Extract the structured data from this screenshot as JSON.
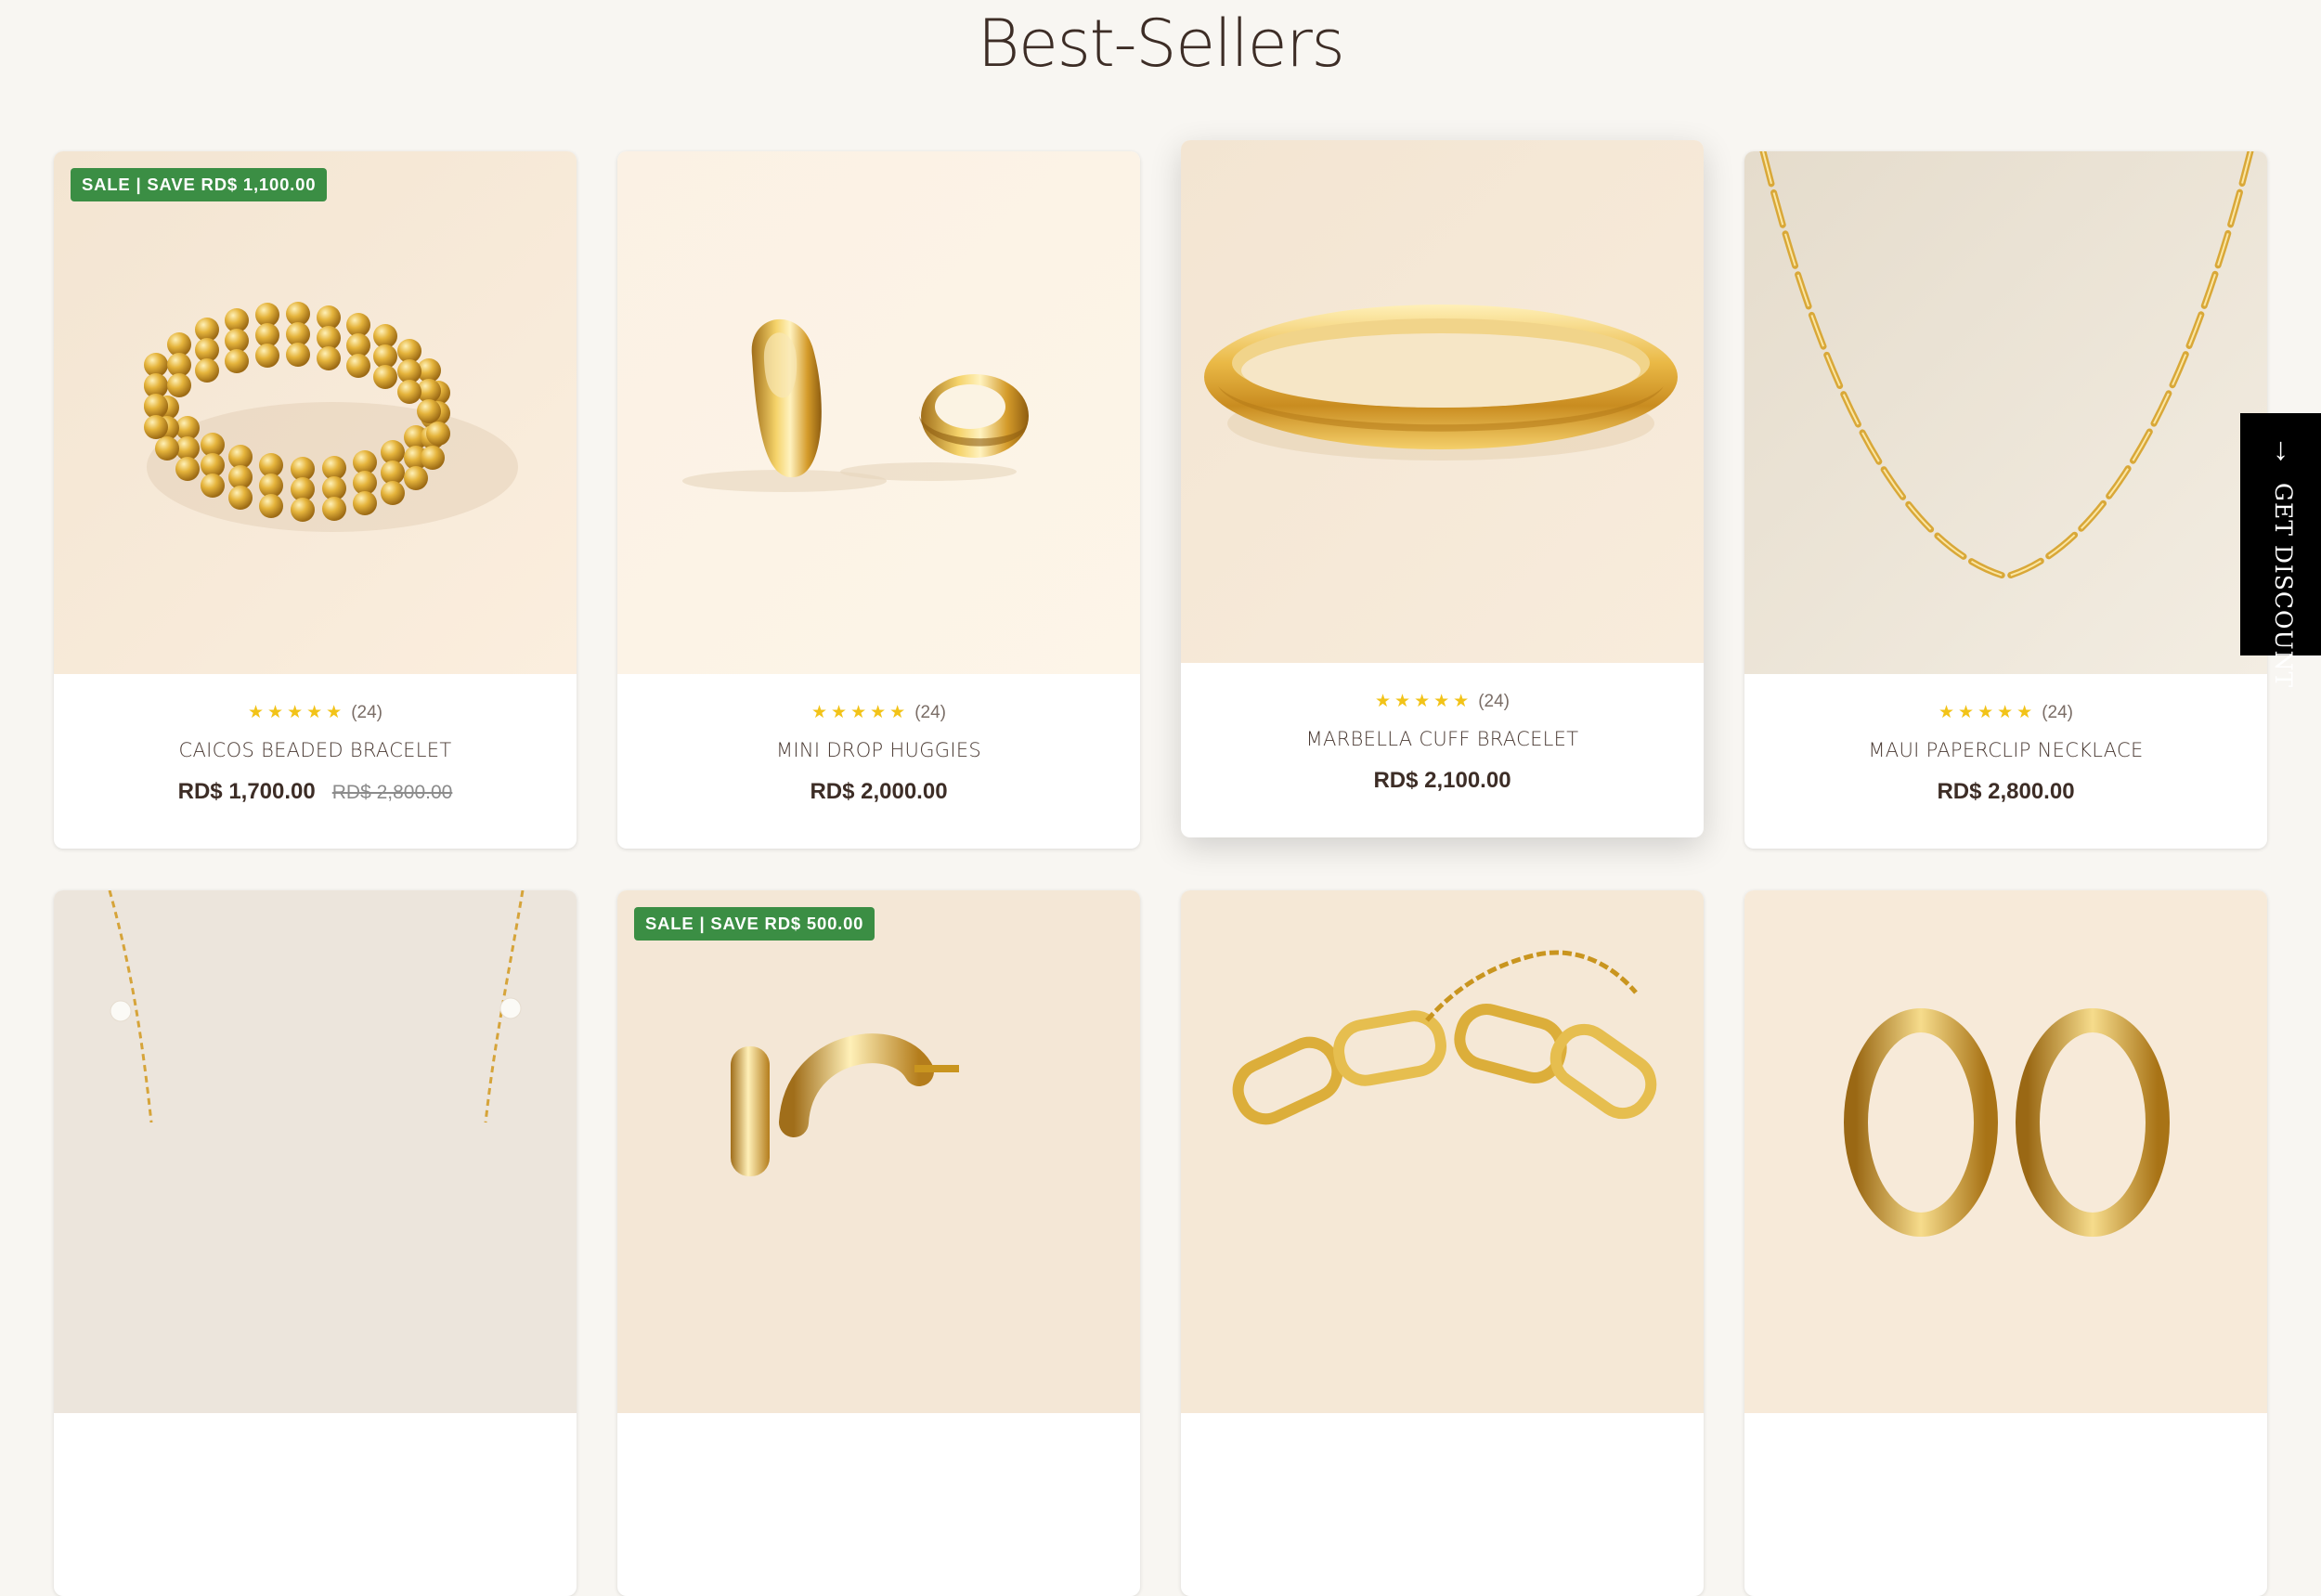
{
  "section": {
    "title": "Best-Sellers"
  },
  "colors": {
    "background": "#f8f6f2",
    "sale_badge": "#3b8e44",
    "stars": "#f2c318",
    "discount_tab": "#000000"
  },
  "discount_tab": {
    "label": "GET DISCOUNT",
    "icon": "arrow-down-icon",
    "arrow": "↓"
  },
  "products": [
    {
      "badge": "SALE | SAVE RD$ 1,100.00",
      "stars": "★★★★★",
      "rating": 5,
      "review_count": "(24)",
      "name": "CAICOS BEADED BRACELET",
      "price": "RD$ 1,700.00",
      "compare_price": "RD$ 2,800.00",
      "image": "gold-beaded-bracelet"
    },
    {
      "stars": "★★★★★",
      "rating": 5,
      "review_count": "(24)",
      "name": "MINI DROP HUGGIES",
      "price": "RD$ 2,000.00",
      "image": "gold-huggie-earrings"
    },
    {
      "stars": "★★★★★",
      "rating": 5,
      "review_count": "(24)",
      "name": "MARBELLA CUFF BRACELET",
      "price": "RD$ 2,100.00",
      "image": "gold-cuff-bracelet"
    },
    {
      "stars": "★★★★★",
      "rating": 5,
      "review_count": "(24)",
      "name": "MAUI PAPERCLIP NECKLACE",
      "price": "RD$ 2,800.00",
      "image": "gold-paperclip-necklace"
    },
    {
      "image": "gold-pearl-station-necklace"
    },
    {
      "badge": "SALE | SAVE RD$ 500.00",
      "image": "gold-hoop-earrings"
    },
    {
      "image": "gold-chain-link-bracelet"
    },
    {
      "image": "gold-chunky-hoops"
    }
  ]
}
